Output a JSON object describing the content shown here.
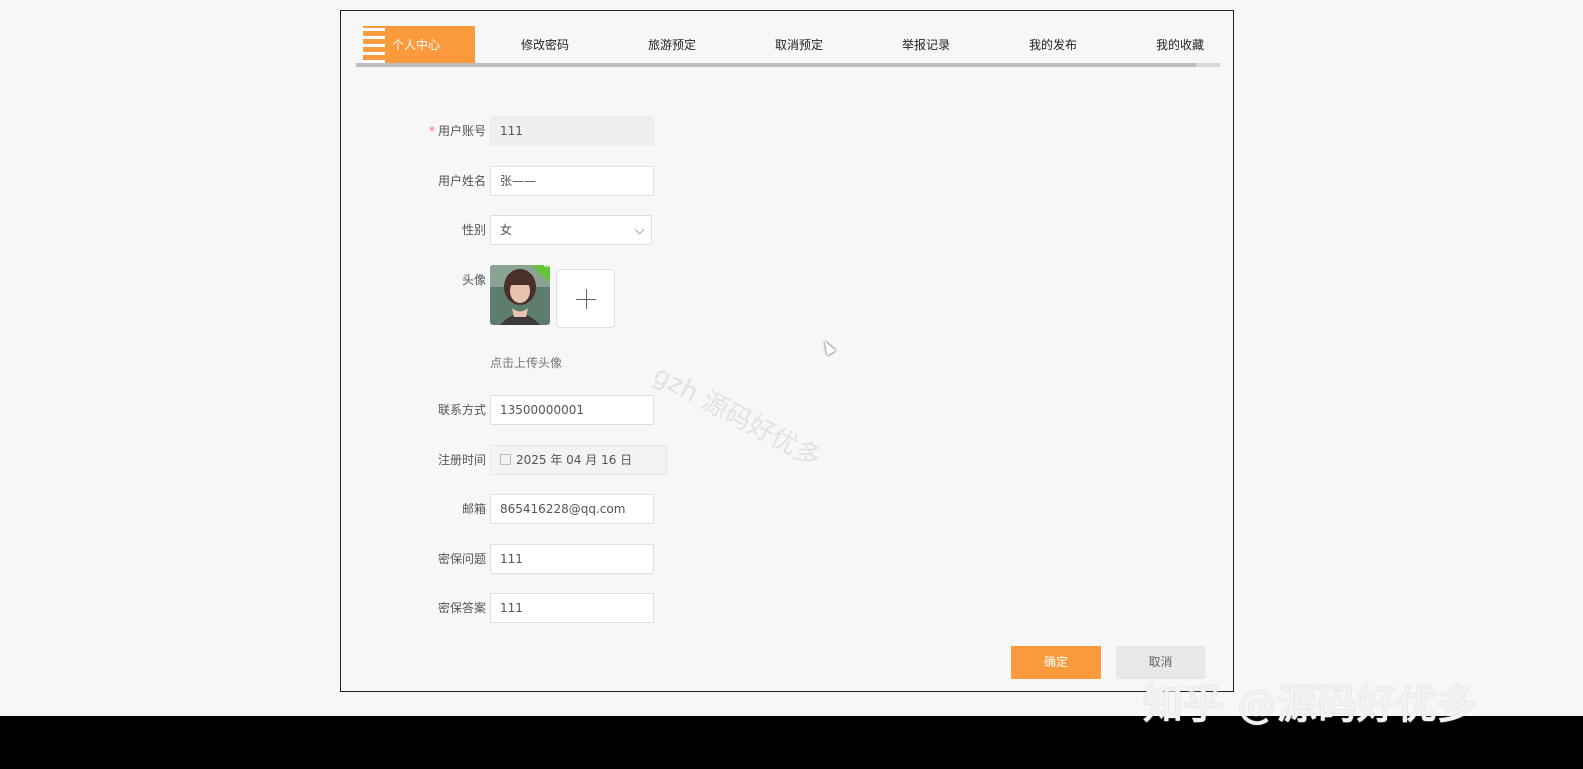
{
  "tabs": [
    {
      "label": "个人中心"
    },
    {
      "label": "修改密码"
    },
    {
      "label": "旅游预定"
    },
    {
      "label": "取消预定"
    },
    {
      "label": "举报记录"
    },
    {
      "label": "我的发布"
    },
    {
      "label": "我的收藏"
    }
  ],
  "form": {
    "account": {
      "label": "用户账号",
      "value": "111",
      "required_mark": "*"
    },
    "name": {
      "label": "用户姓名",
      "value": "张——"
    },
    "gender": {
      "label": "性别",
      "value": "女"
    },
    "avatar": {
      "label": "头像",
      "hint": "点击上传头像"
    },
    "phone": {
      "label": "联系方式",
      "value": "13500000001"
    },
    "register_time": {
      "label": "注册时间",
      "value": "2025 年 04 月 16 日"
    },
    "email": {
      "label": "邮箱",
      "value": "865416228@qq.com"
    },
    "security_question": {
      "label": "密保问题",
      "value": "111"
    },
    "security_answer": {
      "label": "密保答案",
      "value": "111"
    }
  },
  "buttons": {
    "confirm": "确定",
    "cancel": "取消"
  },
  "watermark": "gzh 源码好优多",
  "brand_watermark": "知乎 @源码好优多",
  "colors": {
    "accent": "#fb9a3c",
    "success": "#67c23a",
    "required": "#f56c6c"
  }
}
